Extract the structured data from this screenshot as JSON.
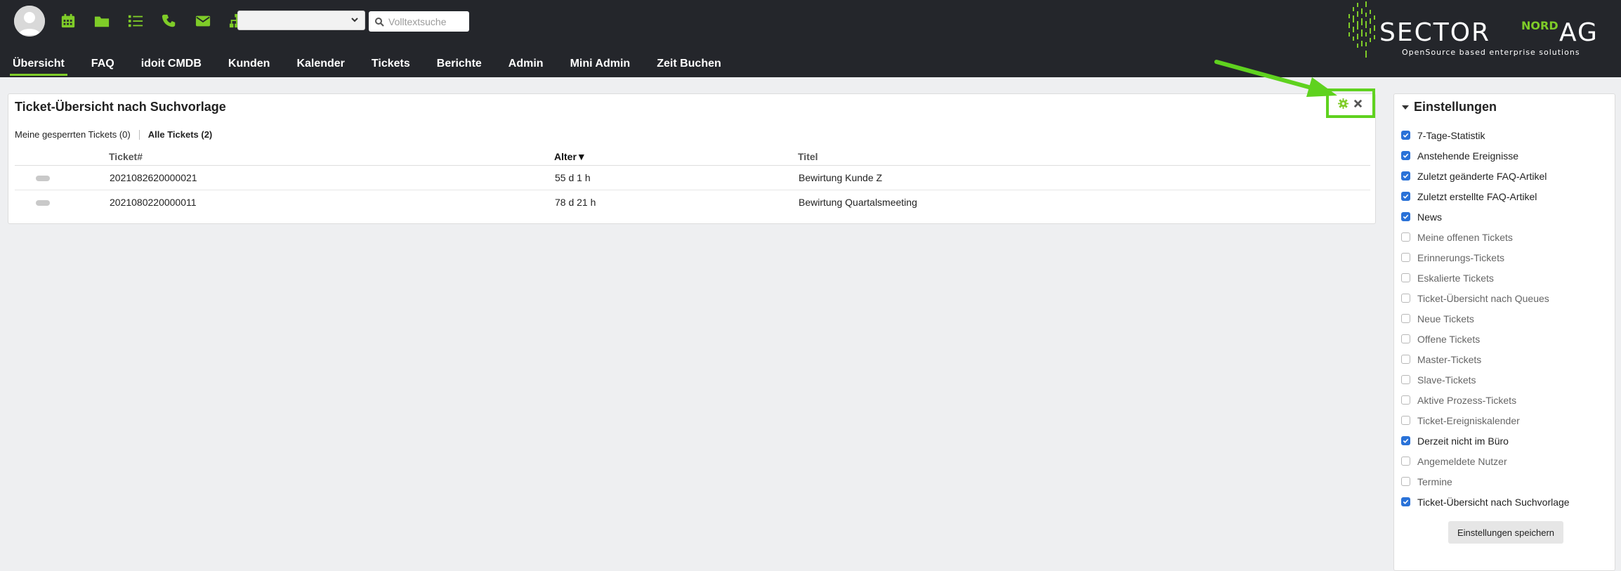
{
  "header": {
    "search_placeholder": "Volltextsuche",
    "queue_select_value": "",
    "tool_icons": [
      "calendar-icon",
      "folder-icon",
      "list-icon",
      "phone-icon",
      "envelope-icon",
      "sitemap-icon"
    ],
    "accent_color": "#7fcc28"
  },
  "nav": {
    "items": [
      "Übersicht",
      "FAQ",
      "idoit CMDB",
      "Kunden",
      "Kalender",
      "Tickets",
      "Berichte",
      "Admin",
      "Mini Admin",
      "Zeit Buchen"
    ],
    "active": "Übersicht"
  },
  "logo": {
    "brand": "SECTORNORDAG",
    "tagline": "OpenSource based enterprise solutions"
  },
  "panel": {
    "title": "Ticket-Übersicht nach Suchvorlage",
    "filters": [
      "Meine gesperrten Tickets (0)",
      "Alle Tickets (2)"
    ],
    "selected_filter": "Alle Tickets (2)",
    "columns": [
      "Ticket#",
      "Alter▼",
      "Titel"
    ],
    "sorted_column": "Alter▼",
    "rows": [
      {
        "ticket": "2021082620000021",
        "age": "55 d 1 h",
        "title": "Bewirtung Kunde Z"
      },
      {
        "ticket": "2021080220000011",
        "age": "78 d 21 h",
        "title": "Bewirtung Quartalsmeeting"
      }
    ],
    "action_icons": [
      "gear-icon",
      "close-icon"
    ]
  },
  "sidebar": {
    "title": "Einstellungen",
    "options": [
      {
        "label": "7-Tage-Statistik",
        "checked": true
      },
      {
        "label": "Anstehende Ereignisse",
        "checked": true
      },
      {
        "label": "Zuletzt geänderte FAQ-Artikel",
        "checked": true
      },
      {
        "label": "Zuletzt erstellte FAQ-Artikel",
        "checked": true
      },
      {
        "label": "News",
        "checked": true
      },
      {
        "label": "Meine offenen Tickets",
        "checked": false
      },
      {
        "label": "Erinnerungs-Tickets",
        "checked": false
      },
      {
        "label": "Eskalierte Tickets",
        "checked": false
      },
      {
        "label": "Ticket-Übersicht nach Queues",
        "checked": false
      },
      {
        "label": "Neue Tickets",
        "checked": false
      },
      {
        "label": "Offene Tickets",
        "checked": false
      },
      {
        "label": "Master-Tickets",
        "checked": false
      },
      {
        "label": "Slave-Tickets",
        "checked": false
      },
      {
        "label": "Aktive Prozess-Tickets",
        "checked": false
      },
      {
        "label": "Ticket-Ereigniskalender",
        "checked": false
      },
      {
        "label": "Derzeit nicht im Büro",
        "checked": true
      },
      {
        "label": "Angemeldete Nutzer",
        "checked": false
      },
      {
        "label": "Termine",
        "checked": false
      },
      {
        "label": "Ticket-Übersicht nach Suchvorlage",
        "checked": true
      }
    ],
    "save_label": "Einstellungen speichern"
  }
}
